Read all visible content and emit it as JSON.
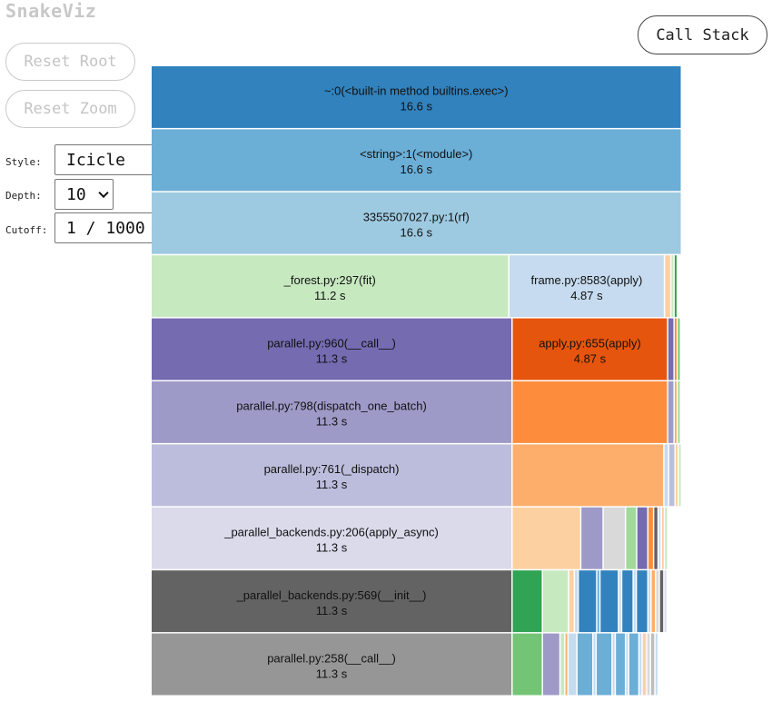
{
  "app": {
    "title": "SnakeViz"
  },
  "buttons": {
    "reset_root": "Reset Root",
    "reset_zoom": "Reset Zoom",
    "call_stack": "Call Stack"
  },
  "controls": {
    "style_label": "Style:",
    "style_value": "Icicle",
    "depth_label": "Depth:",
    "depth_value": "10",
    "cutoff_label": "Cutoff:",
    "cutoff_value": "1 / 1000"
  },
  "chart_data": {
    "type": "icicle",
    "unit": "s",
    "root_total": 16.6,
    "rows": [
      [
        {
          "name": "~:0(<built-in method builtins.exec>)",
          "time": "16.6 s",
          "value": 16.6,
          "color": "#3182bd"
        }
      ],
      [
        {
          "name": "<string>:1(<module>)",
          "time": "16.6 s",
          "value": 16.6,
          "color": "#6baed6"
        }
      ],
      [
        {
          "name": "3355507027.py:1(rf)",
          "time": "16.6 s",
          "value": 16.6,
          "color": "#9ecae1"
        }
      ],
      [
        {
          "name": "_forest.py:297(fit)",
          "time": "11.2 s",
          "value": 11.2,
          "color": "#c7e9c0"
        },
        {
          "name": "frame.py:8583(apply)",
          "time": "4.87 s",
          "value": 4.87,
          "color": "#c6dbef"
        },
        {
          "value": 0.2,
          "color": "#fdd0a2"
        },
        {
          "value": 0.1,
          "color": "#c7e9c0"
        },
        {
          "value": 0.1,
          "color": "#31a354"
        }
      ],
      [
        {
          "name": "parallel.py:960(__call__)",
          "time": "11.3 s",
          "value": 11.3,
          "color": "#756bb1"
        },
        {
          "name": "apply.py:655(apply)",
          "time": "4.87 s",
          "value": 4.87,
          "color": "#e6550d"
        },
        {
          "value": 0.2,
          "color": "#756bb1"
        },
        {
          "value": 0.1,
          "color": "#fd8d3c"
        },
        {
          "value": 0.1,
          "color": "#74c476"
        }
      ],
      [
        {
          "name": "parallel.py:798(dispatch_one_batch)",
          "time": "11.3 s",
          "value": 11.3,
          "color": "#9e9ac8"
        },
        {
          "value": 4.87,
          "color": "#fd8d3c"
        },
        {
          "value": 0.2,
          "color": "#9e9ac8"
        },
        {
          "value": 0.1,
          "color": "#fdae6b"
        },
        {
          "value": 0.1,
          "color": "#a1d99b"
        }
      ],
      [
        {
          "name": "parallel.py:761(_dispatch)",
          "time": "11.3 s",
          "value": 11.3,
          "color": "#bcbddc"
        },
        {
          "value": 4.75,
          "color": "#fdae6b"
        },
        {
          "value": 0.15,
          "color": "#c6dbef"
        },
        {
          "value": 0.2,
          "color": "#bcbddc"
        },
        {
          "value": 0.1,
          "color": "#fdd0a2"
        },
        {
          "value": 0.1,
          "color": "#c7e9c0"
        }
      ],
      [
        {
          "name": "_parallel_backends.py:206(apply_async)",
          "time": "11.3 s",
          "value": 11.3,
          "color": "#dadaeb"
        },
        {
          "value": 2.15,
          "color": "#fdd0a2"
        },
        {
          "value": 0.7,
          "color": "#9e9ac8"
        },
        {
          "value": 0.7,
          "color": "#d9d9d9"
        },
        {
          "value": 0.35,
          "color": "#a1d99b"
        },
        {
          "value": 0.35,
          "color": "#756bb1"
        },
        {
          "value": 0.18,
          "color": "#fd8d3c"
        },
        {
          "value": 0.14,
          "color": "#636363"
        },
        {
          "value": 0.1,
          "color": "#dadaeb"
        },
        {
          "value": 0.1,
          "color": "#fdd0a2"
        },
        {
          "value": 0.1,
          "color": "#c7e9c0"
        }
      ],
      [
        {
          "name": "_parallel_backends.py:569(__init__)",
          "time": "11.3 s",
          "value": 11.3,
          "color": "#636363"
        },
        {
          "value": 0.95,
          "color": "#31a354"
        },
        {
          "value": 0.82,
          "color": "#c7e9c0"
        },
        {
          "value": 0.18,
          "color": "#fdd0a2"
        },
        {
          "value": 0.12,
          "color": "#c6dbef"
        },
        {
          "value": 0.58,
          "color": "#3182bd"
        },
        {
          "value": 0.1,
          "color": "#6baed6"
        },
        {
          "value": 0.58,
          "color": "#3182bd"
        },
        {
          "value": 0.1,
          "color": "#c6dbef"
        },
        {
          "value": 0.36,
          "color": "#3182bd"
        },
        {
          "value": 0.1,
          "color": "#c6dbef"
        },
        {
          "value": 0.36,
          "color": "#3182bd"
        },
        {
          "value": 0.1,
          "color": "#c6dbef"
        },
        {
          "value": 0.14,
          "color": "#fdae6b"
        },
        {
          "value": 0.12,
          "color": "#d9d9d9"
        },
        {
          "value": 0.14,
          "color": "#636363"
        },
        {
          "value": 0.1,
          "color": "#dadaeb"
        }
      ],
      [
        {
          "name": "parallel.py:258(__call__)",
          "time": "11.3 s",
          "value": 11.3,
          "color": "#969696"
        },
        {
          "value": 0.95,
          "color": "#74c476"
        },
        {
          "value": 0.55,
          "color": "#9e9ac8"
        },
        {
          "value": 0.15,
          "color": "#c7e9c0"
        },
        {
          "value": 0.1,
          "color": "#fdae6b"
        },
        {
          "value": 0.28,
          "color": "#c6dbef"
        },
        {
          "value": 0.5,
          "color": "#6baed6"
        },
        {
          "value": 0.1,
          "color": "#c6dbef"
        },
        {
          "value": 0.5,
          "color": "#6baed6"
        },
        {
          "value": 0.1,
          "color": "#c6dbef"
        },
        {
          "value": 0.32,
          "color": "#6baed6"
        },
        {
          "value": 0.1,
          "color": "#c6dbef"
        },
        {
          "value": 0.32,
          "color": "#6baed6"
        },
        {
          "value": 0.1,
          "color": "#c6dbef"
        },
        {
          "value": 0.14,
          "color": "#fdd0a2"
        },
        {
          "value": 0.12,
          "color": "#d9d9d9"
        },
        {
          "value": 0.14,
          "color": "#bdbdbd"
        },
        {
          "value": 0.1,
          "color": "#c6dbef"
        }
      ]
    ]
  }
}
